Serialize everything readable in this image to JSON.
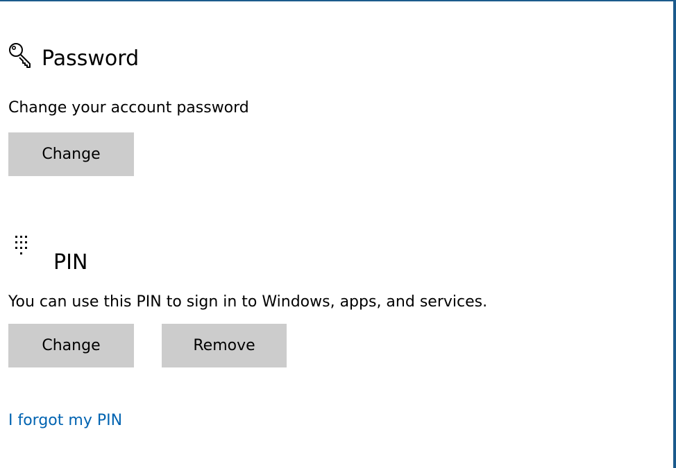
{
  "password_section": {
    "icon": "key-icon",
    "title": "Password",
    "description": "Change your account password",
    "change_label": "Change"
  },
  "pin_section": {
    "icon": "keypad-icon",
    "title": "PIN",
    "description": "You can use this PIN to sign in to Windows, apps, and services.",
    "change_label": "Change",
    "remove_label": "Remove",
    "forgot_link": "I forgot my PIN"
  },
  "colors": {
    "button_bg": "#cccccc",
    "link": "#0063b1",
    "window_border": "#1b5a8c"
  }
}
